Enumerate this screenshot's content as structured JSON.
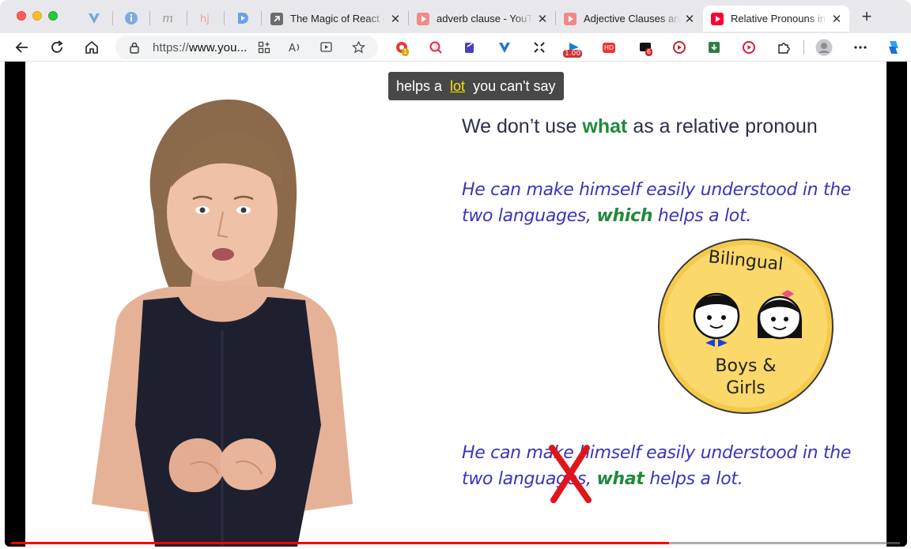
{
  "browser": {
    "pinned_tabs": [
      {
        "icon": "vector-v-icon"
      },
      {
        "icon": "info-circle-icon"
      },
      {
        "icon": "m-letter-icon"
      },
      {
        "icon": "hj-icon"
      },
      {
        "icon": "d-play-icon"
      }
    ],
    "tabs": [
      {
        "title": "The Magic of React -",
        "icon": "external-arrow-icon",
        "active": false
      },
      {
        "title": "adverb clause - YouTube",
        "icon": "youtube-icon",
        "active": false
      },
      {
        "title": "Adjective Clauses and",
        "icon": "youtube-icon",
        "active": false
      },
      {
        "title": "Relative Pronouns in",
        "icon": "youtube-icon",
        "active": true
      }
    ],
    "address": {
      "prefix": "https://",
      "domain": "www.you..."
    },
    "extensions": {
      "badge_one": "1",
      "speed": "1.00",
      "hd": "HD",
      "badge_six": "6"
    }
  },
  "video": {
    "caption": {
      "before": "helps a",
      "highlight": "lot",
      "after": "you can't say"
    },
    "heading": {
      "before": "We don’t use",
      "keyword": "what",
      "after": "as a relative pronoun"
    },
    "sentence_one": {
      "before": "He can make himself easily understood in the two languages,",
      "keyword": "which",
      "after": "helps a lot."
    },
    "sentence_two": {
      "before": "He can make himself easily understood in the two languages,",
      "keyword": "what",
      "after": "helps a lot."
    },
    "badge": {
      "top": "Bilingual",
      "bottom_line1": "Boys &",
      "bottom_line2": "Girls"
    },
    "progress": 0.74,
    "colors": {
      "keyword": "#1f8a3b",
      "sentence": "#3a35b8",
      "cross": "#e0141b",
      "progress": "#ff0000"
    }
  }
}
